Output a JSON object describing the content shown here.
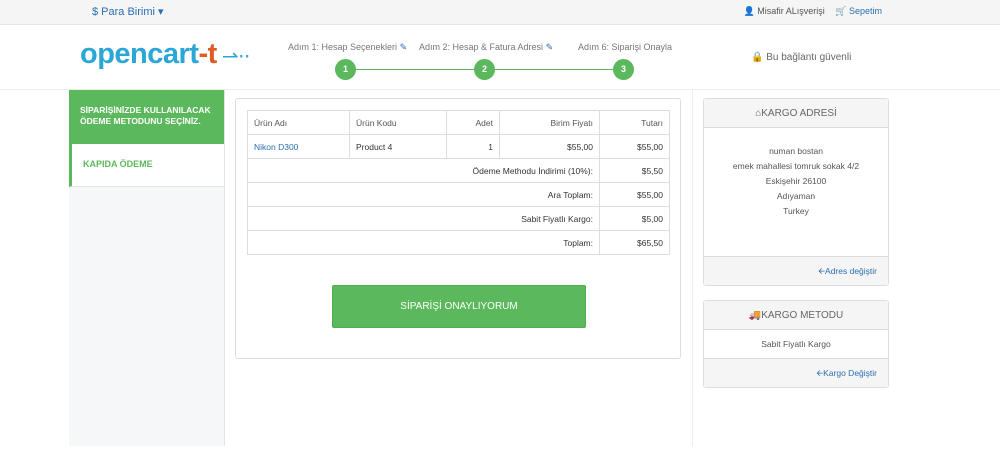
{
  "topbar": {
    "currency_label": "$ Para Birimi ▾",
    "guest_checkout": "Misafir ALışverişi",
    "cart": "Sepetim"
  },
  "header": {
    "logo_main": "opencart",
    "logo_suffix": "-t",
    "steps": [
      {
        "label": "Adım 1: Hesap Seçenekleri",
        "number": "1"
      },
      {
        "label": "Adım 2: Hesap & Fatura Adresi",
        "number": "2"
      },
      {
        "label": "Adım 6: Siparişi Onayla",
        "number": "3"
      }
    ],
    "secure_text": "Bu bağlantı güvenli"
  },
  "left": {
    "heading": "SİPARİŞİNİZDE KULLANILACAK ÖDEME METODUNU SEÇİNİZ.",
    "payment_method": "KAPIDA ÖDEME"
  },
  "order": {
    "columns": [
      "Ürün Adı",
      "Ürün Kodu",
      "Adet",
      "Birim Fiyatı",
      "Tutarı"
    ],
    "items": [
      {
        "name": "Nikon D300",
        "code": "Product 4",
        "qty": "1",
        "unit_price": "$55,00",
        "total": "$55,00"
      }
    ],
    "totals": [
      {
        "label": "Ödeme Methodu İndirimi (10%):",
        "value": "$5,50"
      },
      {
        "label": "Ara Toplam:",
        "value": "$55,00"
      },
      {
        "label": "Sabit Fiyatlı Kargo:",
        "value": "$5,00"
      },
      {
        "label": "Toplam:",
        "value": "$65,50"
      }
    ],
    "confirm_button": "SİPARİŞİ ONAYLIYORUM"
  },
  "shipping_address": {
    "title": "KARGO ADRESİ",
    "lines": [
      "numan bostan",
      "emek mahallesi tomruk sokak 4/2",
      "Eskişehir 26100",
      "Adıyaman",
      "Turkey"
    ],
    "change_link": "Adres değiştir"
  },
  "shipping_method": {
    "title": "KARGO METODU",
    "method": "Sabit Fiyatlı Kargo",
    "change_link": "Kargo Değiştir"
  }
}
